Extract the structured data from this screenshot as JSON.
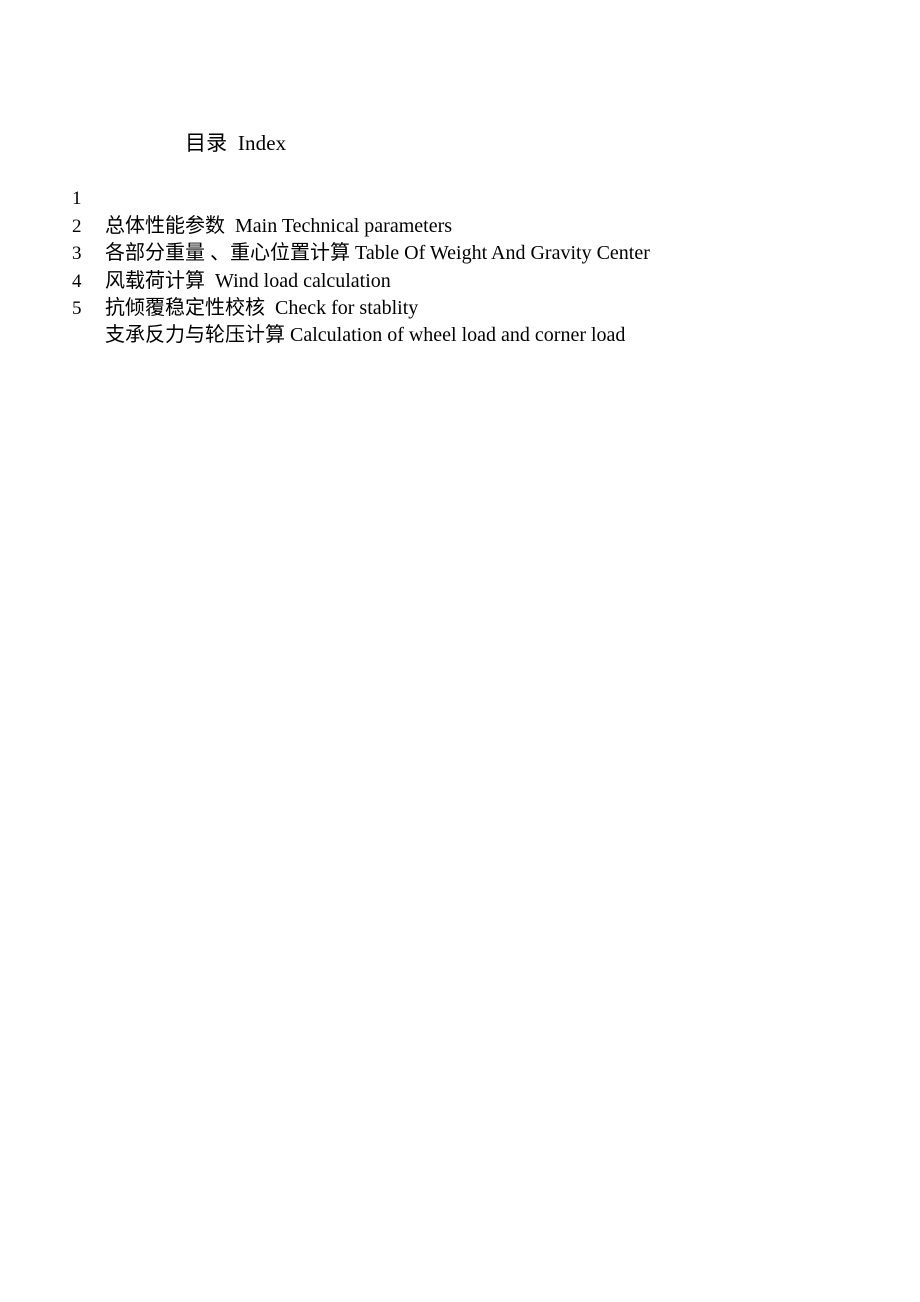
{
  "document": {
    "title_cn": "目录",
    "title_en": "Index",
    "title_full": "目录  Index",
    "page_background": "#ffffff",
    "text_color": "#000000"
  },
  "toc": {
    "entries": [
      {
        "number": "1",
        "cn": "总体性能参数",
        "en": "Main Technical parameters",
        "full": "总体性能参数  Main Technical parameters"
      },
      {
        "number": "2",
        "cn": "各部分重量 、重心位置计算",
        "en": "Table Of Weight And Gravity Center",
        "full": "各部分重量 、重心位置计算 Table Of Weight And Gravity Center"
      },
      {
        "number": "3",
        "cn": "风载荷计算",
        "en": "Wind load calculation",
        "full": "风载荷计算  Wind load calculation"
      },
      {
        "number": "4",
        "cn": "抗倾覆稳定性校核",
        "en": "Check for stablity",
        "full": "抗倾覆稳定性校核  Check for stablity"
      },
      {
        "number": "5",
        "cn": "支承反力与轮压计算",
        "en": "Calculation of wheel load and corner load",
        "full": "支承反力与轮压计算 Calculation of wheel load and corner load"
      }
    ]
  }
}
